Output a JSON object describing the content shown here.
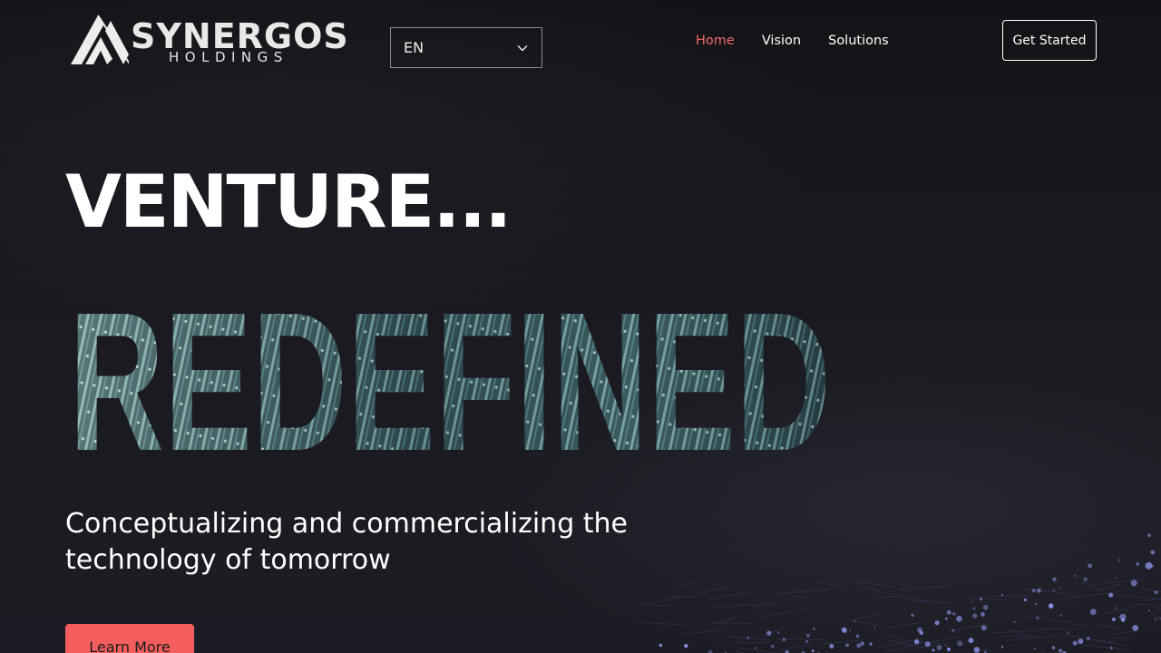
{
  "brand": {
    "name": "SYNERGOS",
    "subtitle": "HOLDINGS"
  },
  "language": {
    "selected": "EN"
  },
  "nav": {
    "items": [
      {
        "label": "Home",
        "active": true
      },
      {
        "label": "Vision",
        "active": false
      },
      {
        "label": "Solutions",
        "active": false
      }
    ],
    "cta_label": "Get Started"
  },
  "hero": {
    "line1": "VENTURE...",
    "line2": "REDEFINED",
    "tagline": "Conceptualizing and commercializing the technology of tomorrow",
    "button_label": "Learn More"
  },
  "colors": {
    "accent": "#f55e5e",
    "nav_active": "#f06a6a",
    "background": "#15151a",
    "text_fill_teal": "#7fa8a8"
  },
  "icons": {
    "logo": "synergos-logo-icon",
    "dropdown": "chevron-down-icon"
  }
}
